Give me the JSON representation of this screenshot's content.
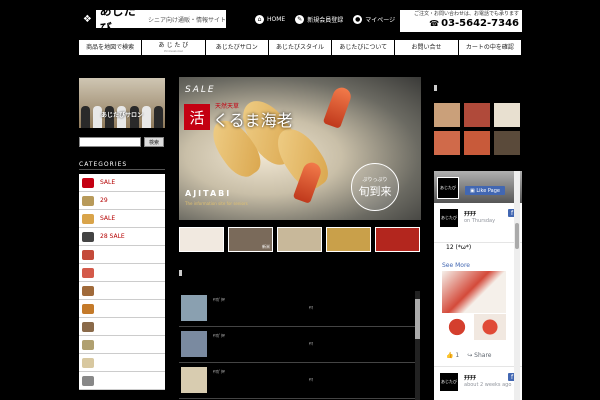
{
  "header": {
    "logo_name": "あじたび",
    "logo_tagline": "シニア向け通販・情報サイト",
    "nav": [
      {
        "label": "HOME",
        "icon": "home-icon"
      },
      {
        "label": "新規会員登録",
        "icon": "pen-icon"
      },
      {
        "label": "マイページ",
        "icon": "person-icon"
      }
    ],
    "phone_note": "ご注文・お問い合わせは、お電話でも承ります",
    "phone_number": "03-5642-7346"
  },
  "main_nav": [
    {
      "label": "商品を地図で検索",
      "sub": ""
    },
    {
      "label": "あ じ た び",
      "sub": "Professional"
    },
    {
      "label": "あじたびサロン",
      "sub": ""
    },
    {
      "label": "あじたびスタイル",
      "sub": ""
    },
    {
      "label": "あじたびについて",
      "sub": ""
    },
    {
      "label": "お問い合せ",
      "sub": ""
    },
    {
      "label": "カートの中を確認",
      "sub": ""
    }
  ],
  "sidebar": {
    "photo_caption": "あじたびサロン",
    "search_button": "検索",
    "categories_title": "CATEGORIES",
    "categories": [
      {
        "label": "SALE",
        "color": "#c40012"
      },
      {
        "label": "29",
        "color": "#b89a5a"
      },
      {
        "label": "SALE",
        "color": "#d9a44a"
      },
      {
        "label": "28 SALE",
        "color": "#444444"
      },
      {
        "label": "",
        "color": "#c44a3a"
      },
      {
        "label": "",
        "color": "#d45a4a"
      },
      {
        "label": "",
        "color": "#a06a3a"
      },
      {
        "label": "",
        "color": "#c47a2a"
      },
      {
        "label": "",
        "color": "#8a6a4a"
      },
      {
        "label": "",
        "color": "#b0a070"
      },
      {
        "label": "",
        "color": "#d8c8a0"
      },
      {
        "label": "",
        "color": "#888888"
      }
    ]
  },
  "hero": {
    "sale": "SALE",
    "badge": "活",
    "subtitle": "天然天草",
    "title": "くるま海老",
    "circle_small": "ぷりっぷり",
    "circle_big": "旬到来",
    "brand": "AJITABI",
    "tagline": "The information site for seniors"
  },
  "thumbs": [
    {
      "label": "",
      "color": "#f1e9e0"
    },
    {
      "label": "新米",
      "color": "#7a6a5a"
    },
    {
      "label": "",
      "color": "#c8b89a"
    },
    {
      "label": "",
      "color": "#c9a04a"
    },
    {
      "label": "",
      "color": "#b3261e"
    }
  ],
  "products": [
    {
      "name": "ﾔﾏｶﾞﾀﾔ",
      "desc": "ﾔﾏ",
      "color": "#8aa0b0"
    },
    {
      "name": "ﾔﾏｶﾞﾀﾔ",
      "desc": "ﾔﾏ",
      "color": "#7a8aa0"
    },
    {
      "name": "ﾔﾏｶﾞﾀﾔ",
      "desc": "ﾔﾏ",
      "color": "#d8ccb0"
    }
  ],
  "right_grid_colors": [
    "#caa07a",
    "#b04a3a",
    "#e8e0d0",
    "#d06a4a",
    "#c85a3a",
    "#5a4a3a"
  ],
  "facebook": {
    "like_label": "Like Page",
    "post1": {
      "name": "ﾁﾁﾁﾁ",
      "meta": "on Thursday"
    },
    "post_text": "12   (*ω*)",
    "see_more": "See More",
    "actions": [
      "1",
      "Share"
    ],
    "post2": {
      "name": "ﾁﾁﾁﾁ",
      "meta": "about 2 weeks ago"
    }
  }
}
